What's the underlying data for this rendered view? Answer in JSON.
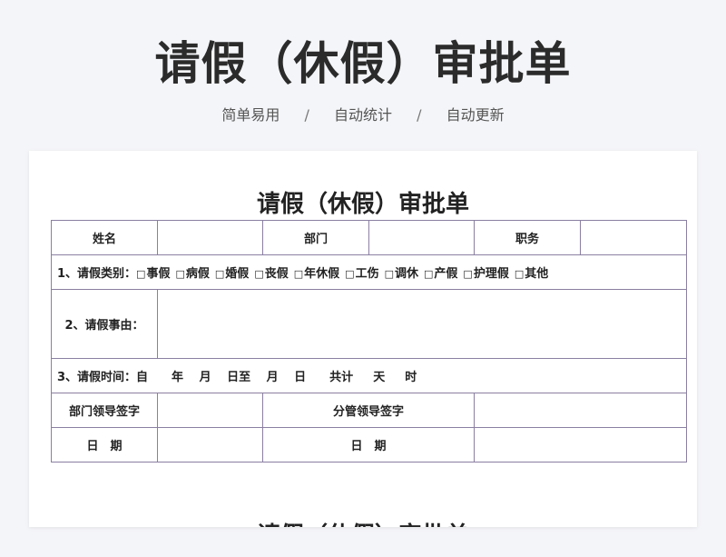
{
  "hero": {
    "title": "请假（休假）审批单",
    "taglines": [
      "简单易用",
      "自动统计",
      "自动更新"
    ],
    "separator": "/"
  },
  "doc": {
    "title": "请假（休假）审批单",
    "next_title": "请假（休假）审批单",
    "border_color": "#8a7fa1",
    "row_info": {
      "name_label": "姓名",
      "dept_label": "部门",
      "position_label": "职务"
    },
    "leave_type": {
      "label": "1、请假类别：",
      "checkbox_glyph": "□",
      "options": [
        "事假",
        "病假",
        "婚假",
        "丧假",
        "年休假",
        "工伤",
        "调休",
        "产假",
        "护理假",
        "其他"
      ]
    },
    "reason": {
      "label": "2、请假事由："
    },
    "time": {
      "label": "3、请假时间：",
      "text": "自　　年　 月　 日至　 月　 日　　共计　  天　  时"
    },
    "sign": {
      "dept_leader": "部门领导签字",
      "supervisor": "分管领导签字",
      "date_label": "日　期"
    }
  }
}
